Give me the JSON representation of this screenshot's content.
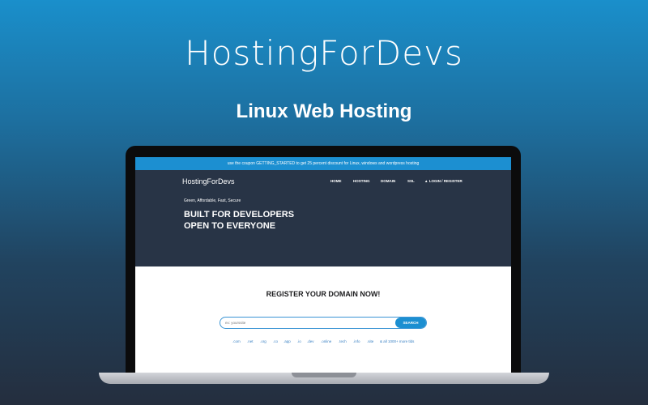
{
  "banner": {
    "brand": "HostingForDevs",
    "headline": "Linux Web Hosting"
  },
  "promo": {
    "text": "use the coupon GETTING_STARTED to get 25 percent discount for Linux, windows and wordpress hosting"
  },
  "site": {
    "logo": "HostingForDevs",
    "nav": [
      "HOME",
      "HOSTING",
      "DOMAIN",
      "SSL"
    ],
    "login_label": "LOGIN / REGISTER",
    "login_icon": "user-icon"
  },
  "hero": {
    "tagline": "Green, Affordable, Fast, Secure",
    "title_line1": "BUILT FOR DEVELOPERS",
    "title_line2": "OPEN TO EVERYONE"
  },
  "domain": {
    "heading": "REGISTER YOUR DOMAIN NOW!",
    "search_placeholder": "ex: yourssite",
    "search_button": "SEARCH",
    "tlds": [
      ".com",
      ".net",
      ".org",
      ".co",
      ".app",
      ".io",
      ".dev",
      ".online",
      ".tech",
      ".info",
      ".site",
      "& all 1000+ more tlds"
    ]
  },
  "colors": {
    "accent": "#1c8fd1",
    "hero_bg": "#283446",
    "link": "#3b82c4"
  }
}
